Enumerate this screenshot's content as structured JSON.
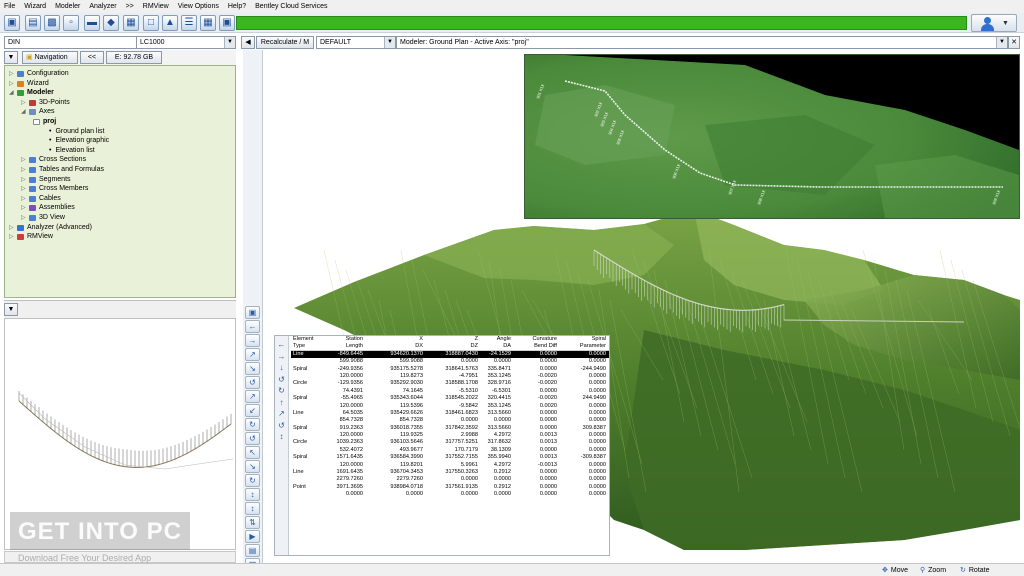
{
  "menu": [
    "File",
    "Wizard",
    "Modeler",
    "Analyzer",
    ">>",
    "RMView",
    "View Options",
    "Help?",
    "Bentley Cloud Services"
  ],
  "toolbar": {
    "progress_color": "#3db521"
  },
  "combos": {
    "unit_system": "DIN",
    "load_case": "LC1000",
    "recalculate": "Recalculate / M",
    "mode": "DEFAULT",
    "status": "Modeler: Ground Plan - Active Axis: \"proj\""
  },
  "nav": {
    "tab_label": "Navigation",
    "collapse_label": "<<",
    "drive_label": "E: 92.78 GB",
    "tree": [
      {
        "label": "Configuration",
        "color": "#4c7fd4"
      },
      {
        "label": "Wizard",
        "color": "#e07f1f"
      },
      {
        "label": "Modeler",
        "color": "#2f9e3d",
        "bold": true
      },
      {
        "label": "3D-Points",
        "color": "#c03a3a"
      },
      {
        "label": "Axes",
        "color": "#6c8fbf"
      },
      {
        "label": "proj",
        "color": "#ffffff",
        "bold": true
      },
      {
        "label": "Ground plan list"
      },
      {
        "label": "Elevation graphic"
      },
      {
        "label": "Elevation list"
      },
      {
        "label": "Cross Sections",
        "color": "#4c7fd4"
      },
      {
        "label": "Tables and Formulas",
        "color": "#4c7fd4"
      },
      {
        "label": "Segments",
        "color": "#4c7fd4"
      },
      {
        "label": "Cross Members",
        "color": "#4c7fd4"
      },
      {
        "label": "Cables",
        "color": "#4c7fd4"
      },
      {
        "label": "Assemblies",
        "color": "#7a4fc0"
      },
      {
        "label": "3D View",
        "color": "#4c7fd4"
      },
      {
        "label": "Analyzer (Advanced)",
        "color": "#3a6fd4"
      },
      {
        "label": "RMView",
        "color": "#d43a3a"
      }
    ]
  },
  "inset_labels": [
    "901 X1X",
    "902 X1X",
    "903 X1X",
    "904 X1X",
    "905 X1X",
    "906 X1X",
    "907 X1X",
    "908 X1X",
    "909 X1X"
  ],
  "table": {
    "header1": [
      "Element",
      "Station",
      "X",
      "Z",
      "Angle",
      "Curvature",
      "Spiral"
    ],
    "header2": [
      "Type",
      "Length",
      "DX",
      "DZ",
      "DA",
      "Bend Diff",
      "Parameter"
    ],
    "rows": [
      [
        "Line",
        "-849.6445",
        "934620.1370",
        "318887.0430",
        "-24.1529",
        "0.0000",
        "0.0000"
      ],
      [
        "",
        "599.9088",
        "599.9088",
        "0.0000",
        "0.0000",
        "0.0000",
        "0.0000"
      ],
      [
        "Spiral",
        "-249.9356",
        "935175.5278",
        "318641.5763",
        "335.8471",
        "0.0000",
        "-244.9490"
      ],
      [
        "",
        "120.0000",
        "119.8273",
        "-4.7951",
        "353.1245",
        "-0.0020",
        "0.0000"
      ],
      [
        "Circle",
        "-129.9356",
        "935292.9030",
        "318588.1708",
        "328.9716",
        "-0.0020",
        "0.0000"
      ],
      [
        "",
        "74.4391",
        "74.1645",
        "-5.5310",
        "-6.5301",
        "0.0000",
        "0.0000"
      ],
      [
        "Spiral",
        "-55.4965",
        "935343.6044",
        "318545.2022",
        "320.4415",
        "-0.0020",
        "244.9490"
      ],
      [
        "",
        "120.0000",
        "119.5396",
        "-9.5842",
        "353.1245",
        "0.0020",
        "0.0000"
      ],
      [
        "Line",
        "64.5035",
        "935429.6626",
        "318461.6823",
        "313.5660",
        "0.0000",
        "0.0000"
      ],
      [
        "",
        "854.7328",
        "854.7328",
        "0.0000",
        "0.0000",
        "0.0000",
        "0.0000"
      ],
      [
        "Spiral",
        "919.2363",
        "936018.7355",
        "317842.3592",
        "313.5660",
        "0.0000",
        "309.8387"
      ],
      [
        "",
        "120.0000",
        "119.9325",
        "2.9988",
        "4.2972",
        "0.0013",
        "0.0000"
      ],
      [
        "Circle",
        "1039.2363",
        "936103.5646",
        "317757.5251",
        "317.8632",
        "0.0013",
        "0.0000"
      ],
      [
        "",
        "532.4072",
        "493.9677",
        "170.7179",
        "38.1309",
        "0.0000",
        "0.0000"
      ],
      [
        "Spiral",
        "1571.6435",
        "936584.3990",
        "317552.7155",
        "355.9940",
        "0.0013",
        "-309.8387"
      ],
      [
        "",
        "120.0000",
        "119.8201",
        "5.9961",
        "4.2972",
        "-0.0013",
        "0.0000"
      ],
      [
        "Line",
        "1691.6435",
        "936704.3453",
        "317550.3263",
        "0.2912",
        "0.0000",
        "0.0000"
      ],
      [
        "",
        "2279.7260",
        "2279.7260",
        "0.0000",
        "0.0000",
        "0.0000",
        "0.0000"
      ],
      [
        "Point",
        "3971.3695",
        "938984.0718",
        "317561.9135",
        "0.2912",
        "0.0000",
        "0.0000"
      ],
      [
        "",
        "0.0000",
        "0.0000",
        "0.0000",
        "0.0000",
        "0.0000",
        "0.0000"
      ]
    ]
  },
  "status_bar": {
    "move": "Move",
    "zoom": "Zoom",
    "rotate": "Rotate"
  },
  "watermark": {
    "title": "GET INTO PC",
    "subtitle": "Download Free Your Desired App"
  }
}
